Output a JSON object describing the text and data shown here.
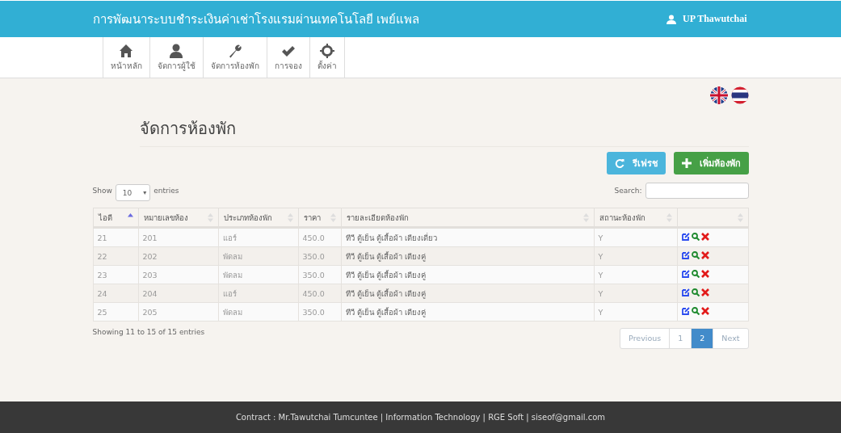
{
  "header": {
    "title": "การพัฒนาระบบชำระเงินค่าเช่าโรงแรมผ่านเทคโนโลยี เพย์แพล",
    "user": "UP Thawutchai"
  },
  "nav": [
    {
      "label": "หน้าหลัก"
    },
    {
      "label": "จัดการผู้ใช้"
    },
    {
      "label": "จัดการห้องพัก"
    },
    {
      "label": "การจอง"
    },
    {
      "label": "ตั้งค่า"
    }
  ],
  "page_title": "จัดการห้องพัก",
  "buttons": [
    {
      "label": "รีเฟรช",
      "kind": "refresh"
    },
    {
      "label": "เพิ่มห้องพัก",
      "kind": "add"
    }
  ],
  "length": {
    "show": "Show",
    "value": "10",
    "caret": "▾",
    "entries": "entries"
  },
  "search": {
    "label": "Search:"
  },
  "table": {
    "columns": [
      {
        "label": "ไอดี",
        "sorted": true
      },
      {
        "label": "หมายเลขห้อง",
        "sorted": false
      },
      {
        "label": "ประเภทห้องพัก",
        "sorted": false
      },
      {
        "label": "ราคา",
        "sorted": false
      },
      {
        "label": "รายละเอียดห้องพัก",
        "sorted": false
      },
      {
        "label": "สถานะห้องพัก",
        "sorted": false
      },
      {
        "sorted": false
      }
    ],
    "rows": [
      [
        "21",
        "201",
        "แอร์",
        "450.0",
        "ทีวี ตู้เย็น ตู้เสื้อผ้า เตียงเดี่ยว",
        "Y"
      ],
      [
        "22",
        "202",
        "พัดลม",
        "350.0",
        "ทีวี ตู้เย็น ตู้เสื้อผ้า เตียงคู่",
        "Y"
      ],
      [
        "23",
        "203",
        "พัดลม",
        "350.0",
        "ทีวี ตู้เย็น ตู้เสื้อผ้า เตียงคู่",
        "Y"
      ],
      [
        "24",
        "204",
        "แอร์",
        "450.0",
        "ทีวี ตู้เย็น ตู้เสื้อผ้า เตียงคู่",
        "Y"
      ],
      [
        "25",
        "205",
        "พัดลม",
        "350.0",
        "ทีวี ตู้เย็น ตู้เสื้อผ้า เตียงคู่",
        "Y"
      ]
    ]
  },
  "info": "Showing 11 to 15 of 15 entries",
  "pagination": [
    {
      "label": "Previous",
      "selected": false
    },
    {
      "label": "1",
      "selected": false
    },
    {
      "label": "2",
      "selected": true
    },
    {
      "label": "Next",
      "selected": false
    }
  ],
  "footer": "Contract : Mr.Tawutchai Tumcuntee | Information Technology | RGE Soft | siseof@gmail.com"
}
